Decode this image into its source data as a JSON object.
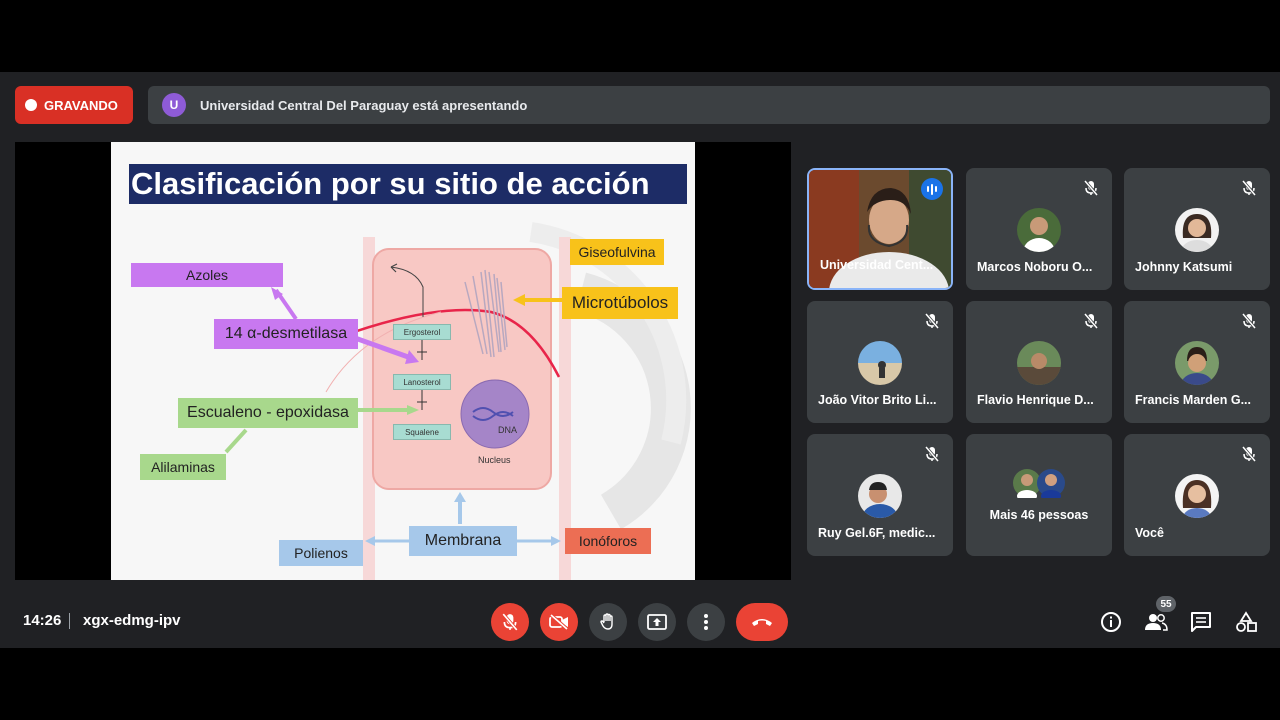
{
  "recording": {
    "label": "GRAVANDO"
  },
  "presenting": {
    "avatar_letter": "U",
    "text": "Universidad Central Del Paraguay está apresentando"
  },
  "slide": {
    "title": "Clasificación por su sitio de acción",
    "labels": {
      "azoles": "Azoles",
      "desmetilasa": "14 α-desmetilasa",
      "escualeno": "Escualeno - epoxidasa",
      "allilaminas": "Alilaminas",
      "giseofulvina": "Giseofulvina",
      "microtubulos": "Microtúbolos",
      "membrana": "Membrana",
      "polienos": "Polienos",
      "ionoforos": "Ionóforos"
    },
    "diagram": {
      "ergosterol": "Ergosterol",
      "lanosterol": "Lanosterol",
      "squalene": "Squalene",
      "dna": "DNA",
      "nucleus": "Nucleus"
    }
  },
  "participants": [
    {
      "name": "Universidad Cent...",
      "speaking": true
    },
    {
      "name": "Marcos Noboru O...",
      "muted": true
    },
    {
      "name": "Johnny Katsumi",
      "muted": true
    },
    {
      "name": "João Vitor Brito Li...",
      "muted": true
    },
    {
      "name": "Flavio Henrique D...",
      "muted": true
    },
    {
      "name": "Francis Marden G...",
      "muted": true
    },
    {
      "name": "Ruy Gel.6F, medic...",
      "muted": true
    },
    {
      "name": "Mais 46 pessoas"
    },
    {
      "name": "Você",
      "muted": true
    }
  ],
  "bottom": {
    "time": "14:26",
    "meeting_code": "xgx-edmg-ipv",
    "people_count": "55"
  },
  "colors": {
    "recording": "#d93025",
    "background": "#202124",
    "tile": "#3c4043",
    "end_call": "#ea4335",
    "slide_title_bg": "#1d2c66"
  }
}
